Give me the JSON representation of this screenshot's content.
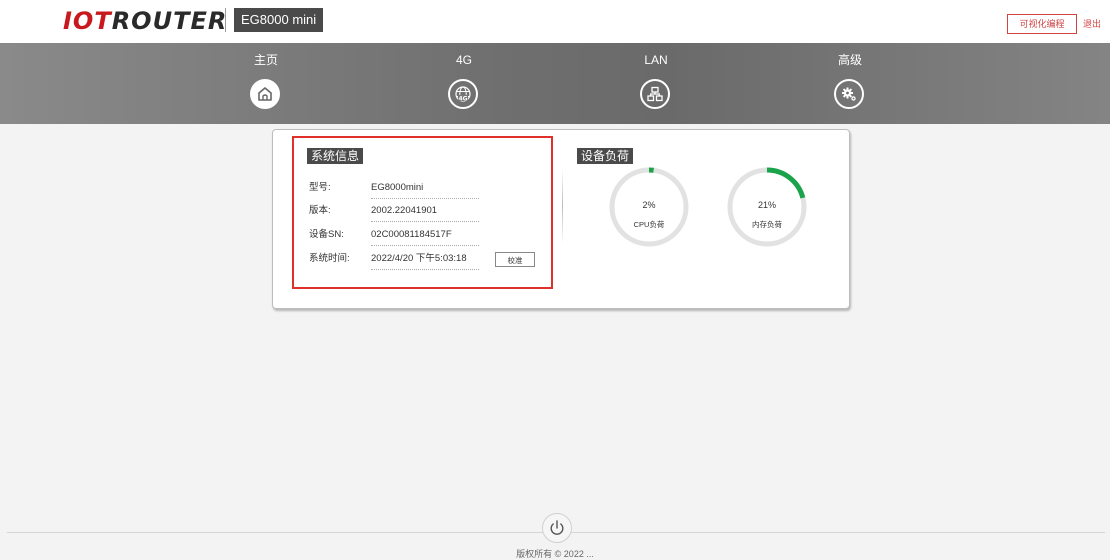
{
  "header": {
    "logo_io": "IOT",
    "logo_rest": "ROUTER",
    "model": "EG8000 mini",
    "visual_programming": "可视化编程",
    "logout": "退出"
  },
  "nav": {
    "items": [
      {
        "label": "主页",
        "icon": "home-icon",
        "active": true
      },
      {
        "label": "4G",
        "icon": "globe-4g-icon",
        "active": false
      },
      {
        "label": "LAN",
        "icon": "network-icon",
        "active": false
      },
      {
        "label": "高级",
        "icon": "gears-icon",
        "active": false
      }
    ]
  },
  "system_info": {
    "title": "系统信息",
    "rows": [
      {
        "key": "型号:",
        "value": "EG8000mini"
      },
      {
        "key": "版本:",
        "value": "2002.22041901"
      },
      {
        "key": "设备SN:",
        "value": "02C00081184517F"
      },
      {
        "key": "系统时间:",
        "value": "2022/4/20 下午5:03:18"
      }
    ],
    "calibrate_button": "校准"
  },
  "device_load": {
    "title": "设备负荷",
    "cpu": {
      "percent": "2%",
      "label": "CPU负荷",
      "fraction": 0.02
    },
    "memory": {
      "percent": "21%",
      "label": "内存负荷",
      "fraction": 0.21
    },
    "track_color": "#e2e2e2",
    "fill_color": "#1aa34a"
  },
  "footer": {
    "copyright": "版权所有 © 2022 ..."
  }
}
